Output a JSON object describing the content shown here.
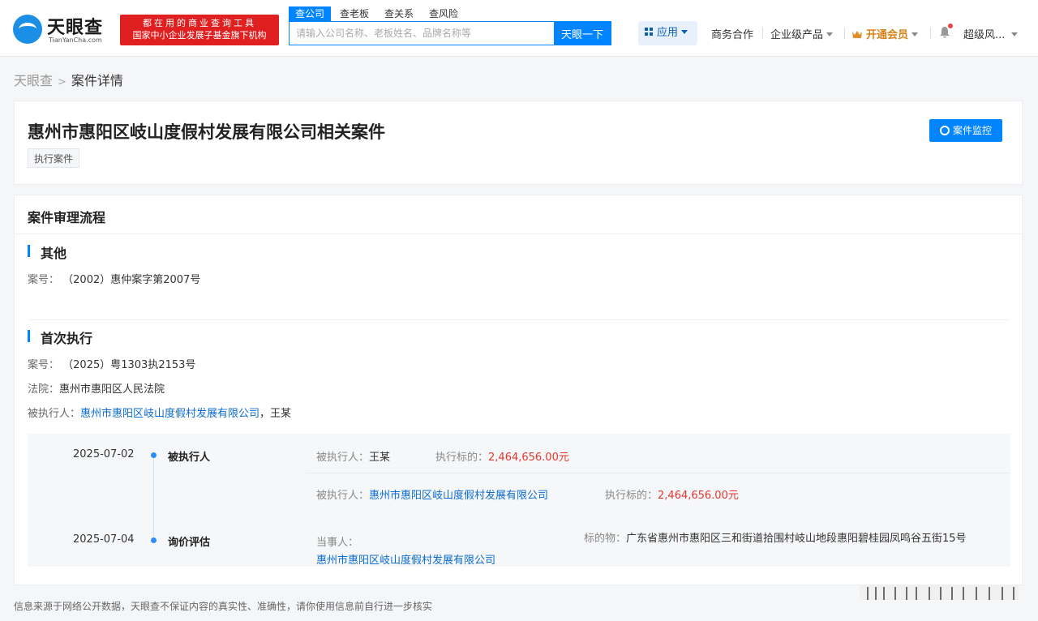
{
  "header": {
    "logo": {
      "name": "天眼查",
      "en": "TianYanCha.com"
    },
    "slogan": {
      "line1": "都在用的商业查询工具",
      "line2": "国家中小企业发展子基金旗下机构"
    },
    "search_tabs": [
      "查公司",
      "查老板",
      "查关系",
      "查风险"
    ],
    "search_placeholder": "请输入公司名称、老板姓名、品牌名称等",
    "search_button": "天眼一下",
    "nav": {
      "app": "应用",
      "business": "商务合作",
      "enterprise": "企业级产品",
      "vip": "开通会员",
      "user": "超级风..."
    }
  },
  "breadcrumb": {
    "root": "天眼查",
    "current": "案件详情"
  },
  "case": {
    "title": "惠州市惠阳区岐山度假村发展有限公司相关案件",
    "tag": "执行案件",
    "monitor_button": "案件监控"
  },
  "process": {
    "title": "案件审理流程",
    "other": {
      "title": "其他",
      "case_no_label": "案号：",
      "case_no": "（2002）惠仲案字第2007号"
    },
    "first_exec": {
      "title": "首次执行",
      "case_no_label": "案号：",
      "case_no": "（2025）粤1303执2153号",
      "court_label": "法院：",
      "court": "惠州市惠阳区人民法院",
      "executed_label": "被执行人：",
      "executed_company": "惠州市惠阳区岐山度假村发展有限公司",
      "executed_sep": "，",
      "executed_person": "王某"
    },
    "timeline": [
      {
        "date": "2025-07-02",
        "type": "被执行人",
        "rows": [
          {
            "person_label": "被执行人：",
            "person": "王某",
            "amount_label": "执行标的：",
            "amount": "2,464,656.00元"
          },
          {
            "person_label": "被执行人：",
            "person": "惠州市惠阳区岐山度假村发展有限公司",
            "amount_label": "执行标的：",
            "amount": "2,464,656.00元"
          }
        ]
      },
      {
        "date": "2025-07-04",
        "type": "询价评估",
        "party_label": "当事人：",
        "party": "惠州市惠阳区岐山度假村发展有限公司",
        "object_label": "标的物：",
        "object": "广东省惠州市惠阳区三和街道拾围村岐山地段惠阳碧桂园凤鸣谷五街15号"
      }
    ]
  },
  "footer": {
    "note": "信息来源于网络公开数据，天眼查不保证内容的真实性、准确性，请你使用信息前自行进一步核实"
  },
  "colors": {
    "primary": "#0084ff",
    "link": "#0b6bcf",
    "amount": "#e5372f",
    "slogan_bg": "#e02020",
    "vip": "#d9821a"
  },
  "icons": [
    "tianyancha-logo-icon",
    "grid-apps-icon",
    "crown-icon",
    "bell-icon",
    "monitor-eye-icon",
    "chevron-right-icon",
    "chevron-down-icon"
  ]
}
